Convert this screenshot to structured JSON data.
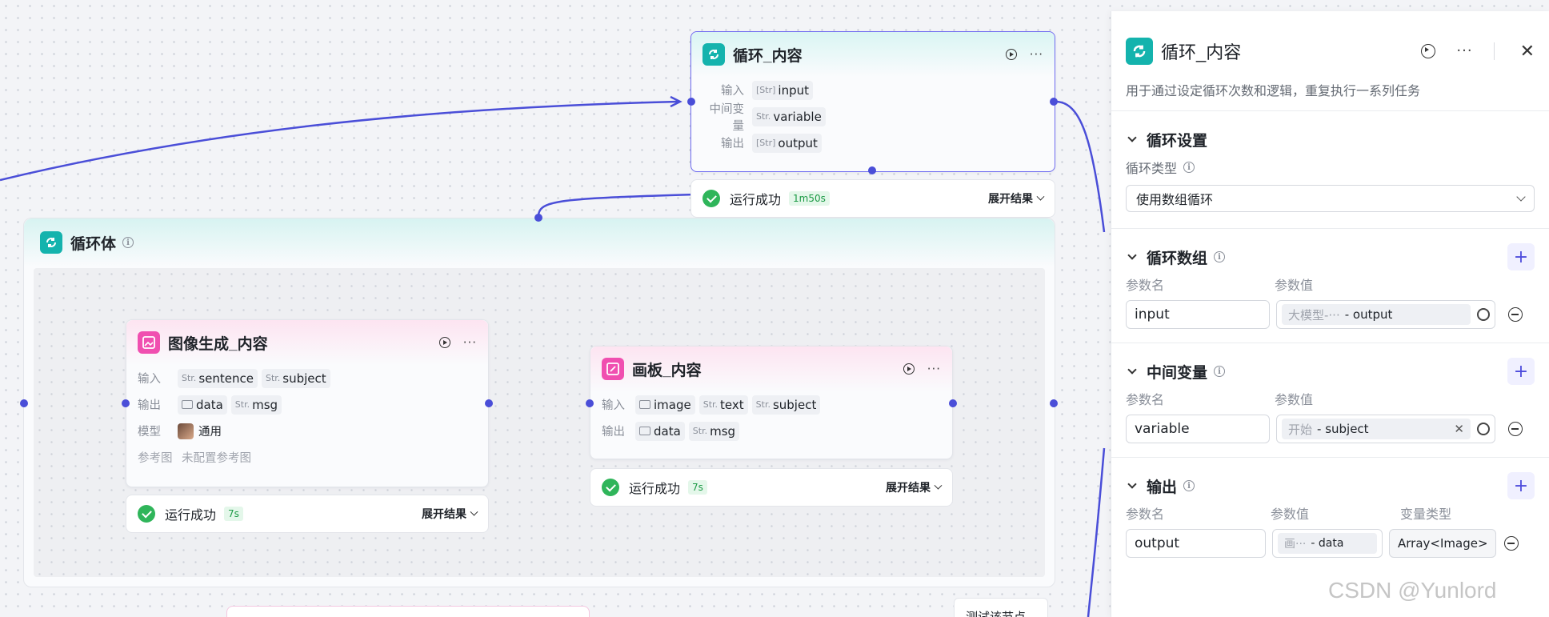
{
  "loop_node": {
    "title": "循环_内容",
    "rows": [
      {
        "label": "输入",
        "type": "[Str]",
        "value": "input"
      },
      {
        "label": "中间变量",
        "type": "Str.",
        "value": "variable"
      },
      {
        "label": "输出",
        "type": "[Str]",
        "value": "output"
      }
    ],
    "status": "运行成功",
    "duration": "1m50s",
    "expand": "展开结果"
  },
  "loop_body": {
    "title": "循环体"
  },
  "image_node": {
    "title": "图像生成_内容",
    "input_label": "输入",
    "inputs": [
      {
        "type": "Str.",
        "value": "sentence"
      },
      {
        "type": "Str.",
        "value": "subject"
      }
    ],
    "output_label": "输出",
    "outputs": [
      {
        "type": "image",
        "value": "data"
      },
      {
        "type": "Str.",
        "value": "msg"
      }
    ],
    "model_label": "模型",
    "model": "通用",
    "ref_label": "参考图",
    "ref_value": "未配置参考图",
    "status": "运行成功",
    "duration": "7s",
    "expand": "展开结果"
  },
  "canvas_node": {
    "title": "画板_内容",
    "input_label": "输入",
    "inputs": [
      {
        "type": "image",
        "value": "image"
      },
      {
        "type": "Str.",
        "value": "text"
      },
      {
        "type": "Str.",
        "value": "subject"
      }
    ],
    "output_label": "输出",
    "outputs": [
      {
        "type": "image",
        "value": "data"
      },
      {
        "type": "Str.",
        "value": "msg"
      }
    ],
    "status": "运行成功",
    "duration": "7s",
    "expand": "展开结果"
  },
  "panel": {
    "title": "循环_内容",
    "description": "用于通过设定循环次数和逻辑，重复执行一系列任务",
    "loop_settings": {
      "title": "循环设置",
      "type_label": "循环类型",
      "type_value": "使用数组循环"
    },
    "loop_array": {
      "title": "循环数组",
      "col_name": "参数名",
      "col_value": "参数值",
      "name": "input",
      "source": "大模型-···",
      "value": "- output"
    },
    "mid_vars": {
      "title": "中间变量",
      "col_name": "参数名",
      "col_value": "参数值",
      "name": "variable",
      "source": "开始",
      "value": "- subject"
    },
    "output": {
      "title": "输出",
      "col_name": "参数名",
      "col_value": "参数值",
      "col_type": "变量类型",
      "name": "output",
      "source": "画···",
      "value": "- data",
      "type": "Array<Image>"
    }
  },
  "test_button": "测试该节点",
  "watermark": "CSDN @Yunlord",
  "colors": {
    "accent": "#4a4ed8",
    "teal": "#14b3ad",
    "pink": "#f04fb0",
    "success": "#2fb55a"
  }
}
